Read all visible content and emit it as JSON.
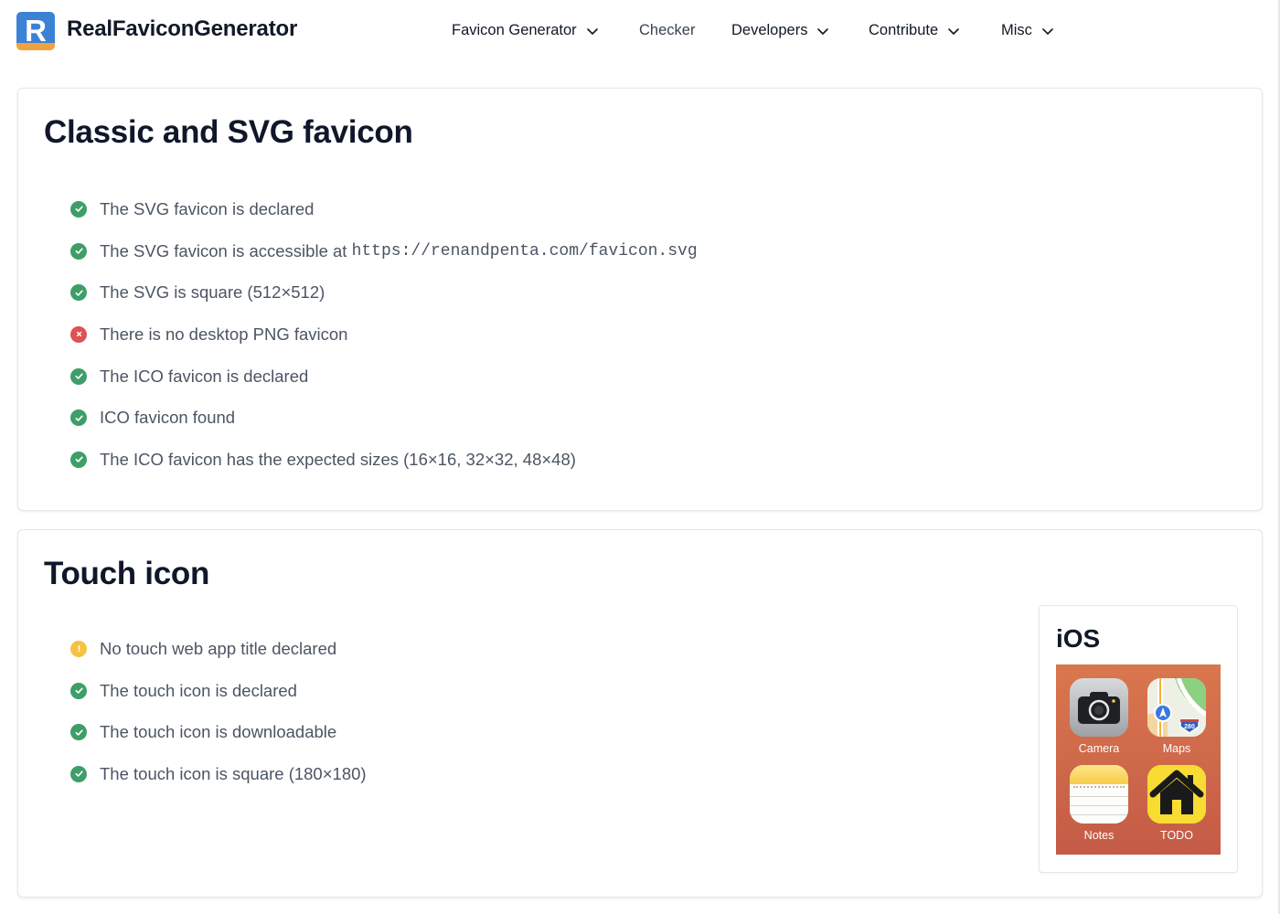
{
  "header": {
    "logo_letter": "R",
    "brand": "RealFaviconGenerator",
    "nav": [
      {
        "label": "Favicon Generator",
        "has_dropdown": true
      },
      {
        "label": "Checker",
        "has_dropdown": false
      },
      {
        "label": "Developers",
        "has_dropdown": true
      },
      {
        "label": "Contribute",
        "has_dropdown": true
      },
      {
        "label": "Misc",
        "has_dropdown": true
      }
    ]
  },
  "sections": {
    "classic": {
      "title": "Classic and SVG favicon",
      "checks": [
        {
          "status": "ok",
          "text": "The SVG favicon is declared"
        },
        {
          "status": "ok",
          "text": "The SVG favicon is accessible at ",
          "code": "https://renandpenta.com/favicon.svg"
        },
        {
          "status": "ok",
          "text": "The SVG is square (512×512)"
        },
        {
          "status": "error",
          "text": "There is no desktop PNG favicon"
        },
        {
          "status": "ok",
          "text": "The ICO favicon is declared"
        },
        {
          "status": "ok",
          "text": "ICO favicon found"
        },
        {
          "status": "ok",
          "text": "The ICO favicon has the expected sizes (16×16, 32×32, 48×48)"
        }
      ]
    },
    "touch": {
      "title": "Touch icon",
      "checks": [
        {
          "status": "warning",
          "text": "No touch web app title declared"
        },
        {
          "status": "ok",
          "text": "The touch icon is declared"
        },
        {
          "status": "ok",
          "text": "The touch icon is downloadable"
        },
        {
          "status": "ok",
          "text": "The touch icon is square (180×180)"
        }
      ],
      "ios_preview": {
        "title": "iOS",
        "apps": {
          "camera": "Camera",
          "maps": "Maps",
          "maps_shield": "280",
          "notes": "Notes",
          "todo": "TODO"
        }
      }
    }
  },
  "colors": {
    "ok": "#3e9e68",
    "error": "#e05252",
    "warning": "#f5c242",
    "brand_blue": "#3b82d6",
    "brand_orange": "#f0a33c"
  }
}
